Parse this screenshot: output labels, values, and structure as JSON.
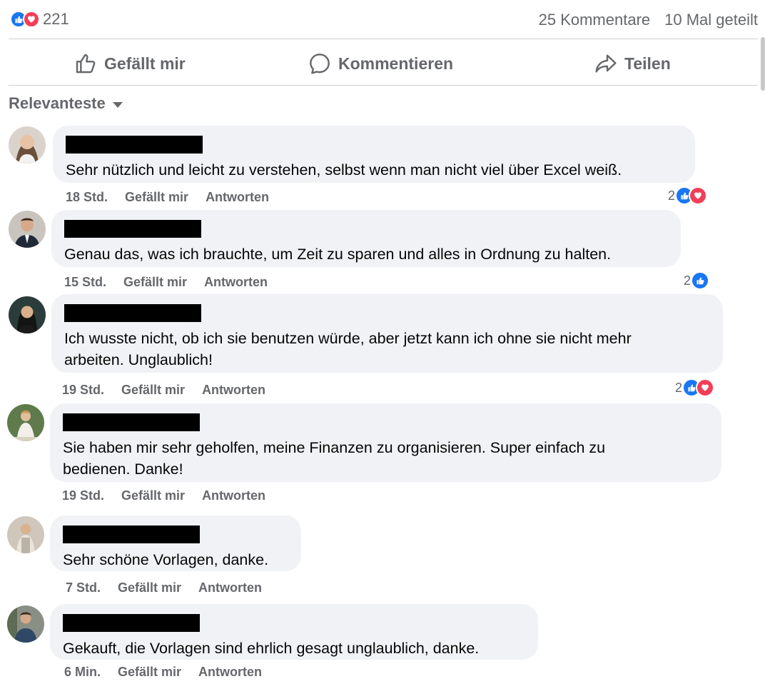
{
  "post_stats": {
    "reaction_icons": [
      "like-icon",
      "love-icon"
    ],
    "reaction_count": "221",
    "comments": "25 Kommentare",
    "shares": "10 Mal geteilt"
  },
  "actions": {
    "like": "Gefällt mir",
    "comment": "Kommentieren",
    "share": "Teilen"
  },
  "sort_label": "Relevanteste",
  "colors": {
    "like_blue": "#1877f2",
    "love_red": "#f33e58",
    "bubble_bg": "#f0f2f5",
    "meta_gray": "#65676b"
  },
  "comments": [
    {
      "text": [
        "Sehr nützlich und leicht zu verstehen, selbst wenn man nicht viel über Excel weiß."
      ],
      "time": "18 Std.",
      "like": "Gefällt mir",
      "reply": "Antworten",
      "reaction_count": "2",
      "reactions": [
        "like",
        "love"
      ]
    },
    {
      "text": [
        "Genau das, was ich brauchte, um Zeit zu sparen und alles in Ordnung zu halten."
      ],
      "time": "15 Std.",
      "like": "Gefällt mir",
      "reply": "Antworten",
      "reaction_count": "2",
      "reactions": [
        "like"
      ]
    },
    {
      "text": [
        "Ich wusste nicht, ob ich sie benutzen würde, aber jetzt kann ich ohne sie nicht mehr",
        "arbeiten. Unglaublich!"
      ],
      "time": "19 Std.",
      "like": "Gefällt mir",
      "reply": "Antworten",
      "reaction_count": "2",
      "reactions": [
        "like",
        "love"
      ]
    },
    {
      "text": [
        "Sie haben mir sehr geholfen, meine Finanzen zu organisieren. Super einfach zu",
        "bedienen. Danke!"
      ],
      "time": "19 Std.",
      "like": "Gefällt mir",
      "reply": "Antworten"
    },
    {
      "text": [
        "Sehr schöne Vorlagen, danke."
      ],
      "time": "7 Std.",
      "like": "Gefällt mir",
      "reply": "Antworten"
    },
    {
      "text": [
        "Gekauft, die Vorlagen sind ehrlich gesagt unglaublich, danke."
      ],
      "time": "6 Min.",
      "like": "Gefällt mir",
      "reply": "Antworten"
    }
  ]
}
